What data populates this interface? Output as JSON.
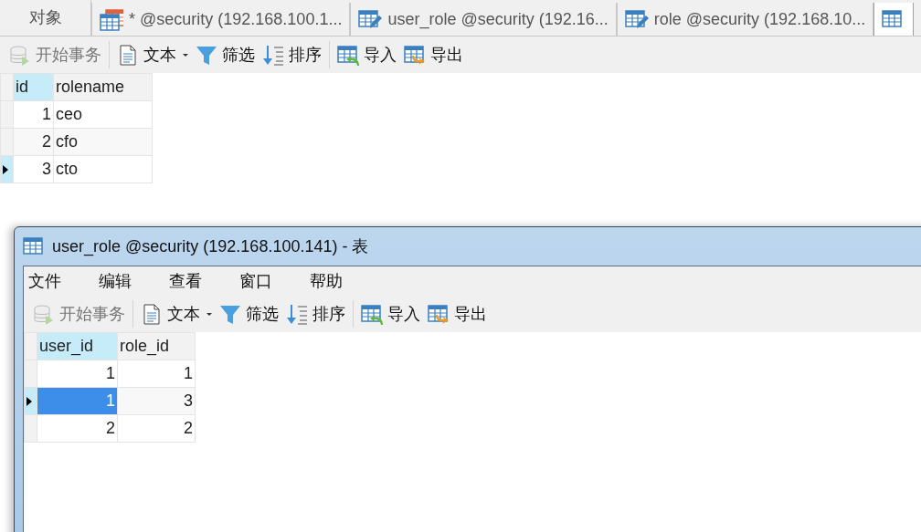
{
  "tabs": [
    {
      "label": "对象",
      "kind": "objects",
      "selected": false
    },
    {
      "label": "*  @security (192.168.100.1...",
      "kind": "query",
      "selected": false
    },
    {
      "label": "user_role @security (192.16...",
      "kind": "edit-table",
      "selected": false
    },
    {
      "label": "role @security (192.168.10...",
      "kind": "edit-table",
      "selected": false
    },
    {
      "kind": "table",
      "selected": true
    }
  ],
  "toolbar": [
    [
      {
        "label": "开始事务",
        "kind": "transaction",
        "disabled": true
      }
    ],
    [
      {
        "label": "文本",
        "kind": "text",
        "disabled": false,
        "dropdown": true
      },
      {
        "label": "筛选",
        "kind": "filter",
        "disabled": false,
        "dropdown": false
      },
      {
        "label": "排序",
        "kind": "sort",
        "disabled": false,
        "dropdown": false
      }
    ],
    [
      {
        "label": "导入",
        "kind": "import",
        "disabled": false
      },
      {
        "label": "导出",
        "kind": "export",
        "disabled": false
      }
    ]
  ],
  "grid": {
    "columns": [
      {
        "label": "id",
        "kind": "number",
        "selected": true
      },
      {
        "label": "rolename",
        "kind": "text",
        "selected": false
      }
    ],
    "rows": [
      {
        "current": false,
        "cells": [
          {
            "value": "1",
            "selected": false
          },
          {
            "value": "ceo",
            "selected": false
          }
        ]
      },
      {
        "current": false,
        "cells": [
          {
            "value": "2",
            "selected": false
          },
          {
            "value": "cfo",
            "selected": false
          }
        ]
      },
      {
        "current": true,
        "cells": [
          {
            "value": "3",
            "selected": false
          },
          {
            "value": "cto",
            "selected": false
          }
        ]
      }
    ]
  },
  "window": {
    "title": "user_role @security (192.168.100.141) - 表",
    "menu": [
      "文件",
      "编辑",
      "查看",
      "窗口",
      "帮助"
    ],
    "toolbar": [
      [
        {
          "label": "开始事务",
          "kind": "transaction",
          "disabled": true
        }
      ],
      [
        {
          "label": "文本",
          "kind": "text",
          "disabled": false,
          "dropdown": true
        },
        {
          "label": "筛选",
          "kind": "filter",
          "disabled": false,
          "dropdown": false
        },
        {
          "label": "排序",
          "kind": "sort",
          "disabled": false,
          "dropdown": false
        }
      ],
      [
        {
          "label": "导入",
          "kind": "import",
          "disabled": false
        },
        {
          "label": "导出",
          "kind": "export",
          "disabled": false
        }
      ]
    ],
    "grid": {
      "columns": [
        {
          "label": "user_id",
          "kind": "number",
          "selected": true
        },
        {
          "label": "role_id",
          "kind": "number",
          "selected": false
        }
      ],
      "rows": [
        {
          "current": false,
          "cells": [
            {
              "value": "1",
              "selected": false
            },
            {
              "value": "1",
              "selected": false
            }
          ]
        },
        {
          "current": true,
          "cells": [
            {
              "value": "1",
              "selected": true
            },
            {
              "value": "3",
              "selected": false
            }
          ]
        },
        {
          "current": false,
          "cells": [
            {
              "value": "2",
              "selected": false
            },
            {
              "value": "2",
              "selected": false
            }
          ]
        }
      ]
    }
  }
}
